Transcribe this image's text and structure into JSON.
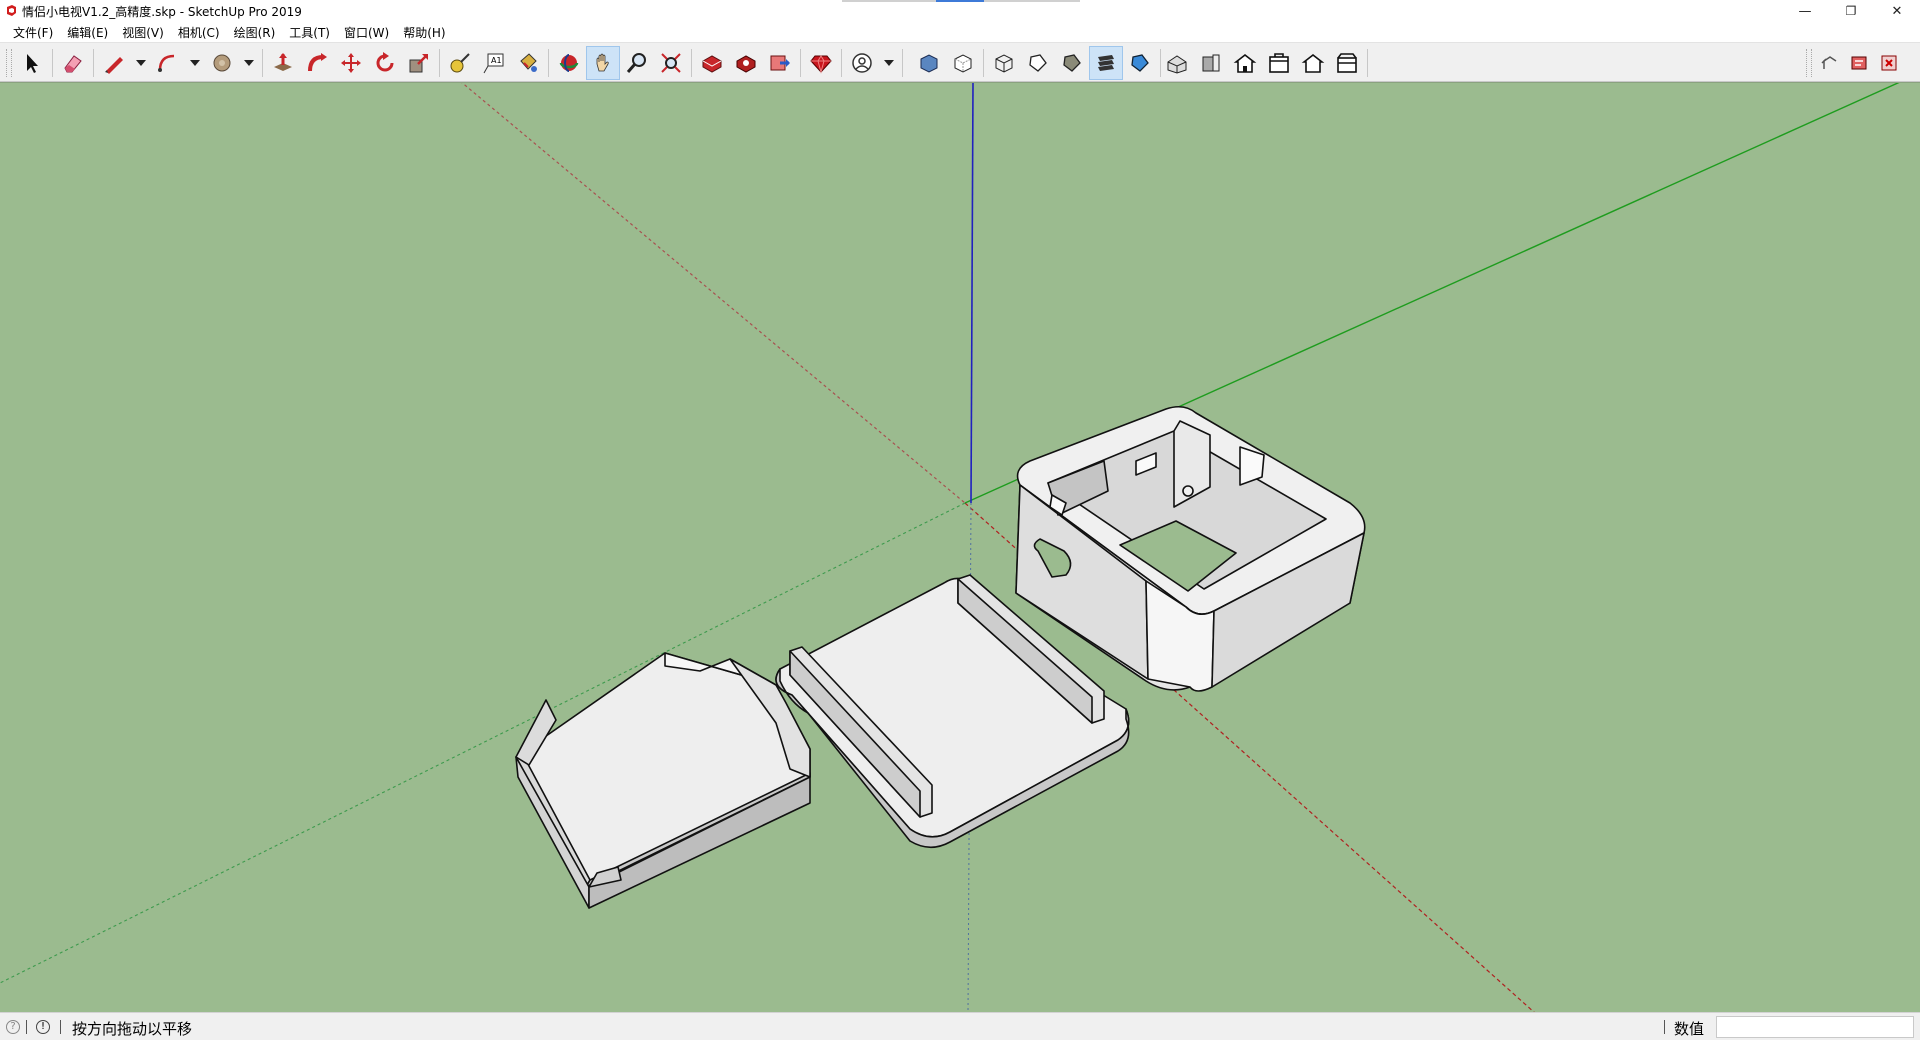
{
  "window": {
    "title": "情侣小电视V1.2_高精度.skp - SketchUp Pro 2019",
    "minimize_glyph": "—",
    "restore_glyph": "❐",
    "close_glyph": "✕",
    "app_icon": "sketchup-logo-icon"
  },
  "menu": {
    "items": [
      "文件(F)",
      "编辑(E)",
      "视图(V)",
      "相机(C)",
      "绘图(R)",
      "工具(T)",
      "窗口(W)",
      "帮助(H)"
    ]
  },
  "toolbar": {
    "tools": [
      "select-icon",
      "eraser-icon",
      "line-icon",
      "arc-icon",
      "shape-icon",
      "push-pull-icon",
      "follow-me-icon",
      "move-icon",
      "rotate-icon",
      "scale-icon",
      "tape-measure-icon",
      "text-icon",
      "paint-bucket-icon",
      "orbit-icon",
      "pan-icon",
      "zoom-icon",
      "zoom-extents-icon",
      "3d-warehouse-icon",
      "extension-warehouse-icon",
      "send-to-layout-icon",
      "ruby-console-icon",
      "account-icon",
      "xray-icon",
      "back-edges-icon",
      "wireframe-icon",
      "hidden-line-icon",
      "shaded-icon",
      "shaded-with-textures-icon",
      "monochrome-icon",
      "iso-view-icon",
      "top-view-icon",
      "front-view-icon",
      "right-view-icon",
      "back-view-icon",
      "left-view-icon",
      "undo-style-icon",
      "extension-a-icon",
      "extension-b-icon"
    ],
    "active_tool": "pan-icon"
  },
  "colors": {
    "background": "#9bbb8f",
    "model_face": "#e9e9e9",
    "model_shadow_face": "#d2d2d2",
    "edge": "#111111",
    "red_axis": "#b02020",
    "green_axis": "#1e9c1e",
    "blue_axis": "#2020c0"
  },
  "status": {
    "message": "按方向拖动以平移",
    "measurements_label": "数值",
    "measurements_value": ""
  }
}
